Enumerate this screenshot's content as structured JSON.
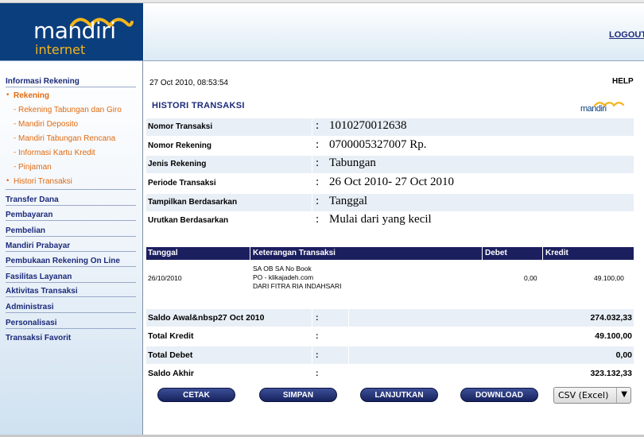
{
  "brand": {
    "name": "mandiri",
    "product": "internet"
  },
  "header": {
    "logout_label": "LOGOUT"
  },
  "sidebar": {
    "sections": [
      {
        "label": "Informasi Rekening"
      },
      {
        "label": "Transfer Dana"
      },
      {
        "label": "Pembayaran"
      },
      {
        "label": "Pembelian"
      },
      {
        "label": "Mandiri Prabayar"
      },
      {
        "label": "Pembukaan Rekening On Line"
      },
      {
        "label": "Fasilitas Layanan"
      },
      {
        "label": "Aktivitas Transaksi"
      },
      {
        "label": "Administrasi"
      },
      {
        "label": "Personalisasi"
      },
      {
        "label": "Transaksi Favorit"
      }
    ],
    "rekening_label": "Rekening",
    "rekening_items": [
      {
        "label": "Rekening Tabungan dan Giro"
      },
      {
        "label": "Mandiri Deposito"
      },
      {
        "label": "Mandiri Tabungan Rencana"
      },
      {
        "label": "Informasi Kartu Kredit"
      },
      {
        "label": "Pinjaman"
      }
    ],
    "histori_label": "Histori Transaksi"
  },
  "page": {
    "datetime": "27 Oct 2010, 08:53:54",
    "help_label": "HELP",
    "title": "HISTORI TRANSAKSI",
    "mini_logo": "mandiri"
  },
  "info": [
    {
      "label": "Nomor Transaksi",
      "colon": ":",
      "value": "1010270012638"
    },
    {
      "label": "Nomor Rekening",
      "colon": ":",
      "value": "0700005327007 Rp."
    },
    {
      "label": "Jenis Rekening",
      "colon": ":",
      "value": "Tabungan"
    },
    {
      "label": "Periode Transaksi",
      "colon": ":",
      "value": "26 Oct 2010- 27 Oct 2010"
    },
    {
      "label": "Tampilkan Berdasarkan",
      "colon": ":",
      "value": "Tanggal"
    },
    {
      "label": "Urutkan Berdasarkan",
      "colon": ":",
      "value": "Mulai dari yang kecil"
    }
  ],
  "transactions": {
    "columns": [
      "Tanggal",
      "Keterangan Transaksi",
      "Debet",
      "Kredit"
    ],
    "rows": [
      {
        "tanggal": "26/10/2010",
        "keterangan": [
          "SA OB SA No Book",
          "PO - klikajadeh.com",
          "DARI FITRA RIA INDAHSARI"
        ],
        "debet": "0,00",
        "kredit": "49.100,00"
      }
    ]
  },
  "summary": [
    {
      "label": "Saldo Awal&nbsp27 Oct 2010",
      "colon": ":",
      "value": "274.032,33"
    },
    {
      "label": "Total Kredit",
      "colon": ":",
      "value": "49.100,00"
    },
    {
      "label": "Total Debet",
      "colon": ":",
      "value": "0,00"
    },
    {
      "label": "Saldo Akhir",
      "colon": ":",
      "value": "323.132,33"
    }
  ],
  "actions": {
    "cetak": "CETAK",
    "simpan": "SIMPAN",
    "lanjutkan": "LANJUTKAN",
    "download": "DOWNLOAD",
    "format_selected": "CSV (Excel)"
  },
  "colors": {
    "brand_navy": "#0b3e7d",
    "brand_gold": "#f5b51b",
    "table_header": "#1c1f5e",
    "link_navy": "#1c2a7a",
    "submenu_orange": "#e06a10",
    "row_shade": "#e8eff6"
  }
}
